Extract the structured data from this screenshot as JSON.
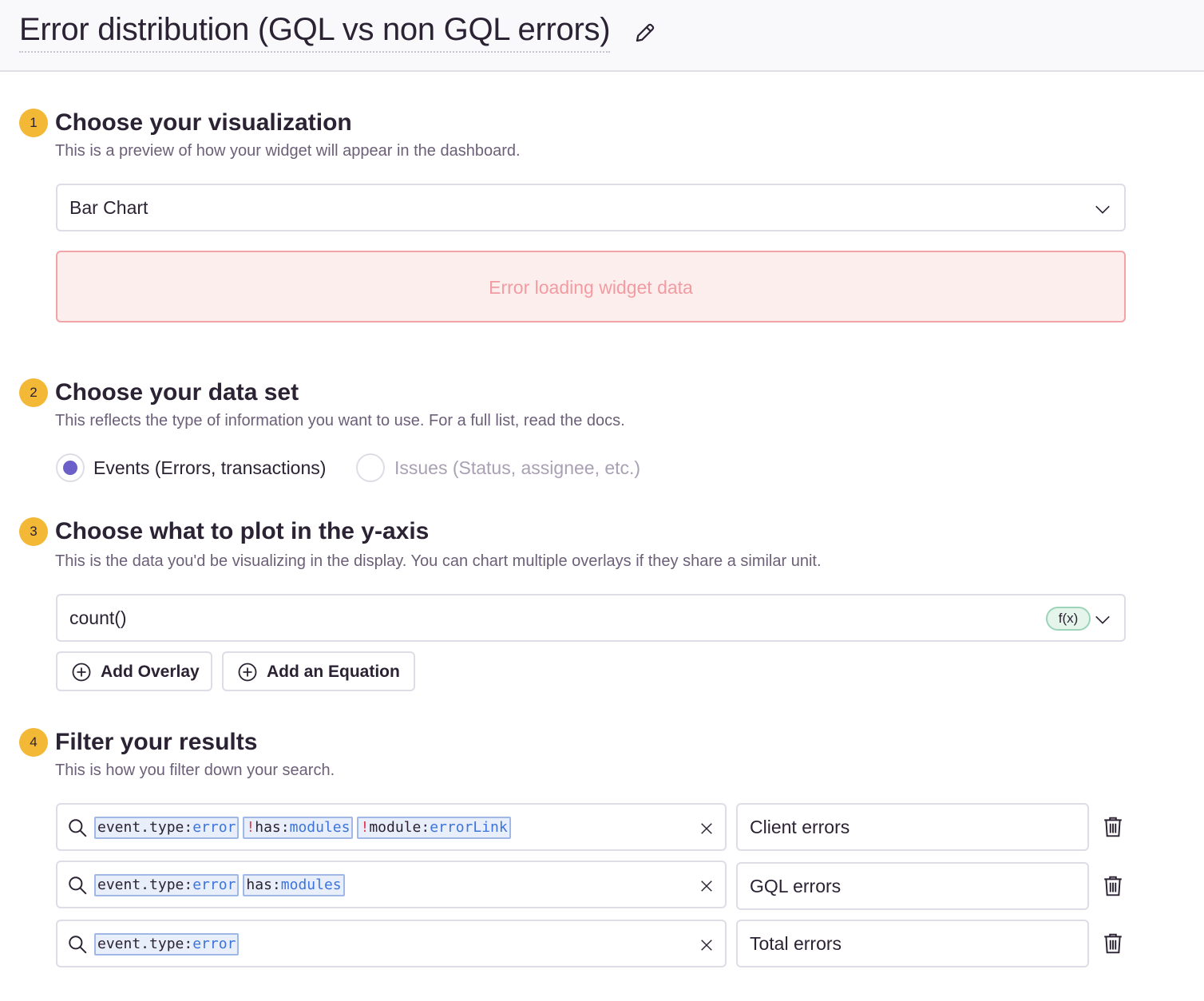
{
  "header": {
    "title": "Error distribution (GQL vs non GQL errors)",
    "edit_icon": "pencil-icon"
  },
  "steps": [
    {
      "number": "1",
      "title": "Choose your visualization",
      "description": "This is a preview of how your widget will appear in the dashboard."
    },
    {
      "number": "2",
      "title": "Choose your data set",
      "description": "This reflects the type of information you want to use. For a full list, read the docs."
    },
    {
      "number": "3",
      "title": "Choose what to plot in the y-axis",
      "description": "This is the data you'd be visualizing in the display. You can chart multiple overlays if they share a similar unit."
    },
    {
      "number": "4",
      "title": "Filter your results",
      "description": "This is how you filter down your search."
    }
  ],
  "visualization": {
    "selected": "Bar Chart",
    "error_message": "Error loading widget data"
  },
  "dataset": {
    "options": [
      {
        "label": "Events (Errors, transactions)",
        "checked": true
      },
      {
        "label": "Issues (Status, assignee, etc.)",
        "checked": false
      }
    ]
  },
  "yaxis": {
    "value": "count()",
    "badge": "f(x)",
    "add_overlay": "Add Overlay",
    "add_equation": "Add an Equation"
  },
  "filters": [
    {
      "tokens": [
        {
          "neg": "",
          "key": "event.type",
          "op": ":",
          "val": "error"
        },
        {
          "neg": "!",
          "key": "has",
          "op": ":",
          "val": "modules"
        },
        {
          "neg": "!",
          "key": "module",
          "op": ":",
          "val": "errorLink"
        }
      ],
      "legend": "Client errors"
    },
    {
      "tokens": [
        {
          "neg": "",
          "key": "event.type",
          "op": ":",
          "val": "error"
        },
        {
          "neg": "",
          "key": "has",
          "op": ":",
          "val": "modules"
        }
      ],
      "legend": "GQL errors"
    },
    {
      "tokens": [
        {
          "neg": "",
          "key": "event.type",
          "op": ":",
          "val": "error"
        }
      ],
      "legend": "Total errors"
    }
  ],
  "colors": {
    "accent": "#6c5fc7",
    "step_badge": "#f2b836",
    "error_bg": "#fdeeee",
    "error_border": "#f2a3a8",
    "error_text": "#f29ba1",
    "token_bg": "#e8effb",
    "token_border": "#9fb8e6",
    "token_value": "#3d74db",
    "token_negation": "#e0384f"
  }
}
